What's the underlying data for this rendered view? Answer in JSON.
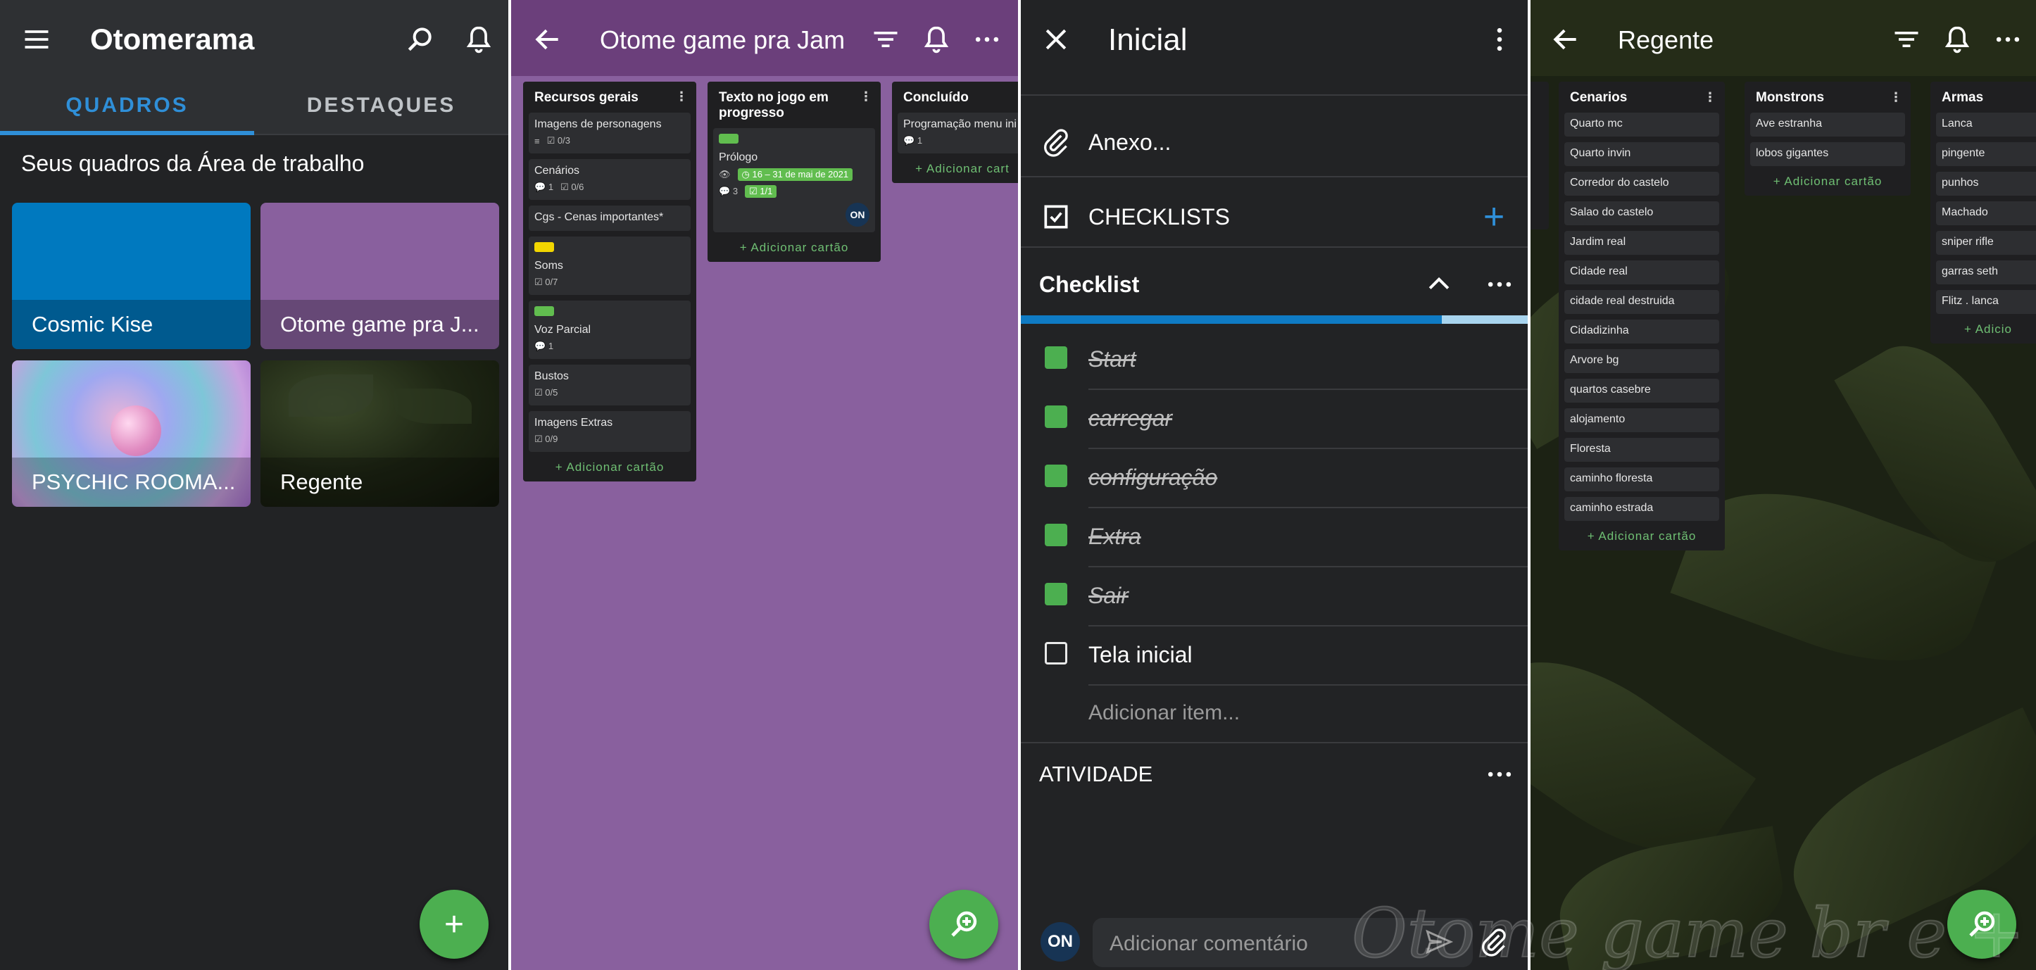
{
  "panel1": {
    "title": "Otomerama",
    "tabs": [
      {
        "label": "QUADROS"
      },
      {
        "label": "DESTAQUES"
      }
    ],
    "section_title": "Seus quadros da Área de trabalho",
    "boards": [
      {
        "name": "Cosmic Kise",
        "color": "#0079bf"
      },
      {
        "name": "Otome game pra J...",
        "color": "#89609e"
      },
      {
        "name": "PSYCHIC ROOMA..."
      },
      {
        "name": "Regente"
      }
    ],
    "fab": "+"
  },
  "panel2": {
    "title": "Otome game pra Jam",
    "lists": [
      {
        "title": "Recursos gerais",
        "cards": [
          {
            "title": "Imagens de personagens",
            "checklist": "0/3"
          },
          {
            "title": "Cenários",
            "comments": "1",
            "checklist": "0/6"
          },
          {
            "title": "Cgs - Cenas importantes*"
          },
          {
            "title": "Soms",
            "checklist": "0/7",
            "label_color": "#f2d600"
          },
          {
            "title": "Voz Parcial",
            "comments": "1",
            "label_color": "#61bd4f"
          },
          {
            "title": "Bustos",
            "checklist": "0/5"
          },
          {
            "title": "Imagens Extras",
            "checklist": "0/9"
          }
        ],
        "add": "+ Adicionar cartão"
      },
      {
        "title": "Texto no jogo em progresso",
        "cards": [
          {
            "title": "Prólogo",
            "date": "16 – 31 de mai de 2021",
            "comments": "3",
            "checklist": "1/1",
            "member": "ON",
            "label_color": "#61bd4f"
          }
        ],
        "add": "+ Adicionar cartão"
      },
      {
        "title": "Concluído",
        "cards": [
          {
            "title": "Programação menu ini",
            "comments": "1"
          }
        ],
        "add": "+ Adicionar cart"
      }
    ]
  },
  "panel3": {
    "title": "Inicial",
    "attachment": "Anexo...",
    "checklists_header": "CHECKLISTS",
    "checklist_title": "Checklist",
    "progress": 0.83,
    "items": [
      {
        "text": "Start",
        "done": true
      },
      {
        "text": "carregar",
        "done": true
      },
      {
        "text": "configuração",
        "done": true
      },
      {
        "text": "Extra",
        "done": true
      },
      {
        "text": "Sair",
        "done": true
      },
      {
        "text": "Tela inicial",
        "done": false
      }
    ],
    "add_item": "Adicionar item...",
    "activity": "ATIVIDADE",
    "member": "ON",
    "comment_placeholder": "Adicionar comentário"
  },
  "panel4": {
    "title": "Regente",
    "lists": [
      {
        "title": "Cenarios",
        "cards": [
          "Quarto mc",
          "Quarto invin",
          "Corredor do castelo",
          "Salao do castelo",
          "Jardim real",
          "Cidade real",
          "cidade real destruida",
          "Cidadizinha",
          "Arvore bg",
          "quartos casebre",
          "alojamento",
          "Floresta",
          "caminho floresta",
          "caminho estrada"
        ],
        "add": "+ Adicionar cartão"
      },
      {
        "title": "Monstrons",
        "cards": [
          "Ave estranha",
          "lobos gigantes"
        ],
        "add": "+ Adicionar cartão"
      },
      {
        "title": "Armas",
        "cards": [
          "Lanca",
          "pingente",
          "punhos",
          "Machado",
          "sniper rifle",
          "garras seth",
          "Flitz . lanca"
        ],
        "add": "+ Adicio"
      }
    ],
    "watermark": "Otome game br e +"
  },
  "colors": {
    "accent": "#2f8fd8",
    "success": "#4caf50",
    "purple": "#89609e",
    "blue_board": "#0079bf"
  }
}
